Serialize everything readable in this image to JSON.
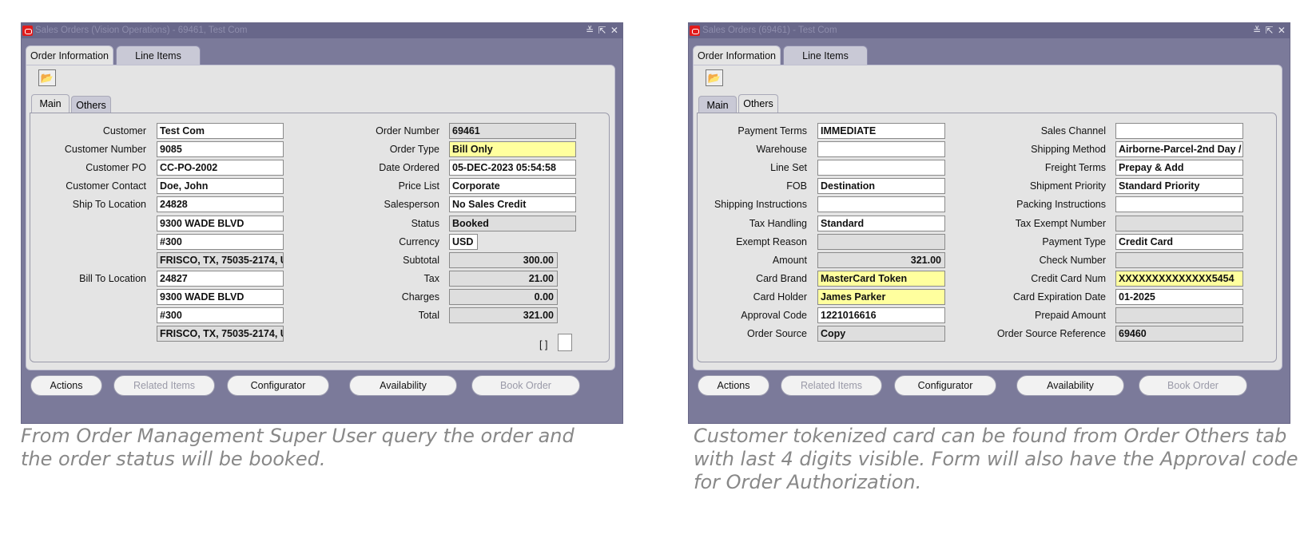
{
  "windows": [
    {
      "title": "Sales Orders (Vision Operations) - 69461, Test Com",
      "title_controls": "≚ ⇱ ✕",
      "tabs": [
        "Order Information",
        "Line Items"
      ],
      "subtabs": [
        "Main",
        "Others"
      ],
      "active_subtab": "Main",
      "left_fields": [
        {
          "label": "Customer",
          "value": "Test Com",
          "style": "normal"
        },
        {
          "label": "Customer Number",
          "value": "9085",
          "style": "normal"
        },
        {
          "label": "Customer PO",
          "value": "CC-PO-2002",
          "style": "normal"
        },
        {
          "label": "Customer Contact",
          "value": "Doe, John",
          "style": "normal"
        },
        {
          "label": "Ship To Location",
          "value": "24828",
          "style": "normal"
        },
        {
          "label": "",
          "value": "9300 WADE BLVD",
          "style": "normal"
        },
        {
          "label": "",
          "value": "#300",
          "style": "normal"
        },
        {
          "label": "",
          "value": "FRISCO, TX, 75035-2174, U",
          "style": "ro"
        },
        {
          "label": "Bill To Location",
          "value": "24827",
          "style": "normal"
        },
        {
          "label": "",
          "value": "9300 WADE BLVD",
          "style": "normal"
        },
        {
          "label": "",
          "value": "#300",
          "style": "normal"
        },
        {
          "label": "",
          "value": "FRISCO, TX, 75035-2174, U",
          "style": "ro"
        }
      ],
      "right_fields": [
        {
          "label": "Order Number",
          "value": "69461",
          "style": "ro"
        },
        {
          "label": "Order Type",
          "value": "Bill Only",
          "style": "req"
        },
        {
          "label": "Date Ordered",
          "value": "05-DEC-2023 05:54:58",
          "style": "normal"
        },
        {
          "label": "Price List",
          "value": "Corporate",
          "style": "normal"
        },
        {
          "label": "Salesperson",
          "value": "No Sales Credit",
          "style": "normal"
        },
        {
          "label": "Status",
          "value": "Booked",
          "style": "ro"
        },
        {
          "label": "Currency",
          "value": "USD",
          "style": "normal"
        },
        {
          "label": "Subtotal",
          "value": "300.00",
          "style": "ro-num"
        },
        {
          "label": "Tax",
          "value": "21.00",
          "style": "ro-num"
        },
        {
          "label": "Charges",
          "value": "0.00",
          "style": "ro-num"
        },
        {
          "label": "Total",
          "value": "321.00",
          "style": "ro-num"
        }
      ],
      "bracket_text": "[ ]",
      "buttons": [
        {
          "label": "Actions",
          "enabled": true
        },
        {
          "label": "Related Items",
          "enabled": false
        },
        {
          "label": "Configurator",
          "enabled": true
        },
        {
          "label": "Availability",
          "enabled": true
        },
        {
          "label": "Book Order",
          "enabled": false
        }
      ]
    },
    {
      "title": "Sales Orders (69461) - Test Com",
      "title_controls": "≚ ⇱ ✕",
      "tabs": [
        "Order Information",
        "Line Items"
      ],
      "subtabs": [
        "Main",
        "Others"
      ],
      "active_subtab": "Others",
      "left_fields": [
        {
          "label": "Payment Terms",
          "value": "IMMEDIATE",
          "style": "normal"
        },
        {
          "label": "Warehouse",
          "value": "",
          "style": "normal"
        },
        {
          "label": "Line Set",
          "value": "",
          "style": "normal"
        },
        {
          "label": "FOB",
          "value": "Destination",
          "style": "normal"
        },
        {
          "label": "Shipping Instructions",
          "value": "",
          "style": "normal"
        },
        {
          "label": "Tax Handling",
          "value": "Standard",
          "style": "normal"
        },
        {
          "label": "Exempt Reason",
          "value": "",
          "style": "ro"
        },
        {
          "label": "Amount",
          "value": "321.00",
          "style": "ro-num"
        },
        {
          "label": "Card Brand",
          "value": "MasterCard Token",
          "style": "req"
        },
        {
          "label": "Card Holder",
          "value": "James Parker",
          "style": "req"
        },
        {
          "label": "Approval Code",
          "value": "1221016616",
          "style": "normal"
        },
        {
          "label": "Order Source",
          "value": "Copy",
          "style": "ro"
        }
      ],
      "right_fields": [
        {
          "label": "Sales Channel",
          "value": "",
          "style": "normal"
        },
        {
          "label": "Shipping Method",
          "value": "Airborne-Parcel-2nd Day /",
          "style": "normal"
        },
        {
          "label": "Freight Terms",
          "value": "Prepay & Add",
          "style": "normal"
        },
        {
          "label": "Shipment Priority",
          "value": "Standard Priority",
          "style": "normal"
        },
        {
          "label": "Packing Instructions",
          "value": "",
          "style": "normal"
        },
        {
          "label": "Tax Exempt Number",
          "value": "",
          "style": "ro"
        },
        {
          "label": "Payment Type",
          "value": "Credit Card",
          "style": "normal"
        },
        {
          "label": "Check Number",
          "value": "",
          "style": "ro"
        },
        {
          "label": "Credit Card Num",
          "value": "XXXXXXXXXXXXXX5454",
          "style": "req"
        },
        {
          "label": "Card Expiration Date",
          "value": "01-2025",
          "style": "normal"
        },
        {
          "label": "Prepaid Amount",
          "value": "",
          "style": "ro"
        },
        {
          "label": "Order Source Reference",
          "value": "69460",
          "style": "ro"
        }
      ],
      "buttons": [
        {
          "label": "Actions",
          "enabled": true
        },
        {
          "label": "Related Items",
          "enabled": false
        },
        {
          "label": "Configurator",
          "enabled": true
        },
        {
          "label": "Availability",
          "enabled": true
        },
        {
          "label": "Book Order",
          "enabled": false
        }
      ]
    }
  ],
  "captions": [
    "From Order Management Super User query the order and the order status will be booked.",
    "Customer tokenized card can be found from Order Others tab with last 4 digits visible. Form will also have the Approval code for Order Authorization."
  ],
  "colors": {
    "window_bg": "#7b7a9a",
    "panel_bg": "#e4e4e4",
    "required_field": "#ffff9e",
    "readonly_field": "#dedede",
    "caption_text": "#888888"
  }
}
